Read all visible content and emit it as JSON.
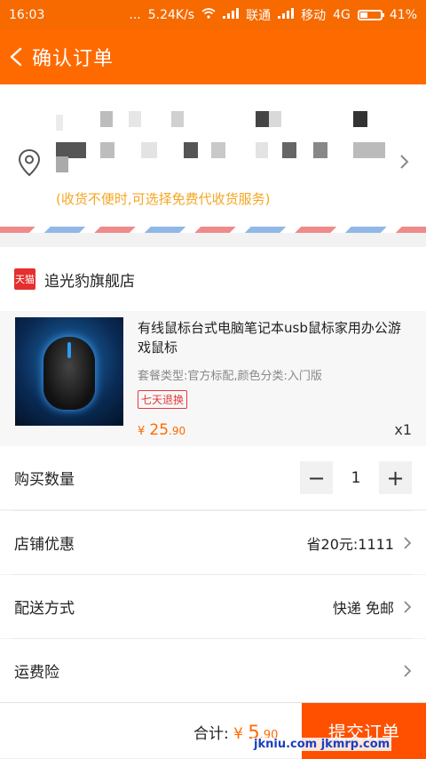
{
  "status_bar": {
    "time": "16:03",
    "dots": "...",
    "network_speed": "5.24K/s",
    "carrier1": "联通",
    "carrier2": "移动",
    "network_type": "4G",
    "battery": "41%",
    "battery_level": 0.41
  },
  "nav": {
    "title": "确认订单"
  },
  "address": {
    "note": "(收货不便时,可选择免费代收货服务)"
  },
  "store": {
    "logo_text": "天猫",
    "name": "追光豹旗舰店"
  },
  "product": {
    "title": "有线鼠标台式电脑笔记本usb鼠标家用办公游戏鼠标",
    "spec": "套餐类型:官方标配,颜色分类:入门版",
    "tag": "七天退换",
    "price_symbol": "¥",
    "price_int": "25",
    "price_dec": ".90",
    "quantity_label": "x1"
  },
  "rows": {
    "qty_label": "购买数量",
    "qty_value": "1",
    "minus": "−",
    "plus": "+",
    "coupon_label": "店铺优惠",
    "coupon_value": "省20元:1111",
    "delivery_label": "配送方式",
    "delivery_value": "快递 免邮",
    "insurance_label": "运费险"
  },
  "footer": {
    "total_label": "合计:",
    "total_symbol": "¥",
    "total_int": "5",
    "total_dec": ".90",
    "submit": "提交订单"
  },
  "watermark": "jkniu.com jkmrp.com",
  "colors": {
    "brand": "#ff6a00",
    "submit": "#ff5000",
    "note": "#f5a623"
  }
}
